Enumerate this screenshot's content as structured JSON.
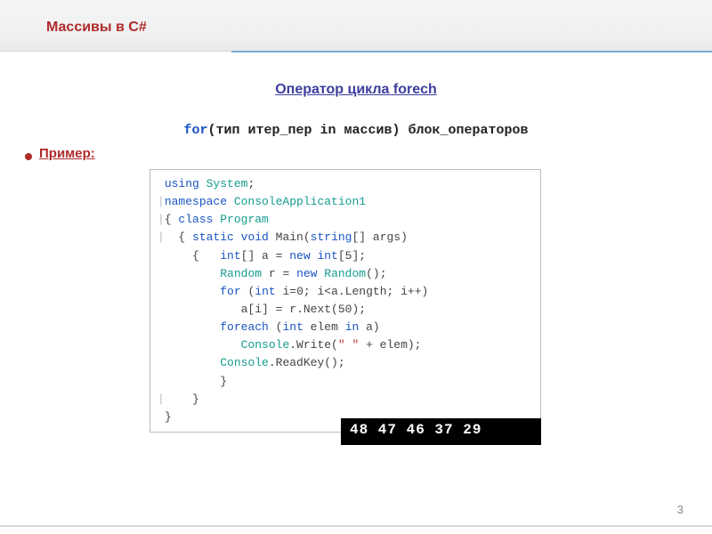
{
  "slide": {
    "title": "Массивы в C#",
    "section": "Оператор цикла forech ",
    "syntax": {
      "kw": "for",
      "rest": "(тип итер_пер in массив) блок_операторов"
    },
    "example_label": "Пример",
    "page_number": "3"
  },
  "code": {
    "lines": [
      {
        "gutter": "",
        "seg": [
          {
            "t": "kw",
            "v": "using "
          },
          {
            "t": "type",
            "v": "System"
          },
          {
            "t": "",
            "v": ";"
          }
        ]
      },
      {
        "gutter": "|",
        "seg": [
          {
            "t": "kw",
            "v": "namespace "
          },
          {
            "t": "type",
            "v": "ConsoleApplication1"
          }
        ]
      },
      {
        "gutter": "|",
        "seg": [
          {
            "t": "",
            "v": "{ "
          },
          {
            "t": "kw",
            "v": "class "
          },
          {
            "t": "type",
            "v": "Program"
          }
        ]
      },
      {
        "gutter": "|",
        "seg": [
          {
            "t": "",
            "v": "  { "
          },
          {
            "t": "kw",
            "v": "static void "
          },
          {
            "t": "",
            "v": "Main("
          },
          {
            "t": "kw",
            "v": "string"
          },
          {
            "t": "",
            "v": "[] args)"
          }
        ]
      },
      {
        "gutter": "",
        "seg": [
          {
            "t": "",
            "v": "    {   "
          },
          {
            "t": "kw",
            "v": "int"
          },
          {
            "t": "",
            "v": "[] a = "
          },
          {
            "t": "kw",
            "v": "new int"
          },
          {
            "t": "",
            "v": "[5];"
          }
        ]
      },
      {
        "gutter": "",
        "seg": [
          {
            "t": "",
            "v": "        "
          },
          {
            "t": "type",
            "v": "Random"
          },
          {
            "t": "",
            "v": " r = "
          },
          {
            "t": "kw",
            "v": "new "
          },
          {
            "t": "type",
            "v": "Random"
          },
          {
            "t": "",
            "v": "();"
          }
        ]
      },
      {
        "gutter": "",
        "seg": [
          {
            "t": "",
            "v": "        "
          },
          {
            "t": "kw",
            "v": "for "
          },
          {
            "t": "",
            "v": "("
          },
          {
            "t": "kw",
            "v": "int"
          },
          {
            "t": "",
            "v": " i=0; i<a.Length; i++)"
          }
        ]
      },
      {
        "gutter": "",
        "seg": [
          {
            "t": "",
            "v": "           a[i] = r.Next(50);"
          }
        ]
      },
      {
        "gutter": "",
        "seg": [
          {
            "t": "",
            "v": "        "
          },
          {
            "t": "kw",
            "v": "foreach "
          },
          {
            "t": "",
            "v": "("
          },
          {
            "t": "kw",
            "v": "int"
          },
          {
            "t": "",
            "v": " elem "
          },
          {
            "t": "kw",
            "v": "in"
          },
          {
            "t": "",
            "v": " a)"
          }
        ]
      },
      {
        "gutter": "",
        "seg": [
          {
            "t": "",
            "v": "           "
          },
          {
            "t": "type",
            "v": "Console"
          },
          {
            "t": "",
            "v": ".Write("
          },
          {
            "t": "str",
            "v": "\" \""
          },
          {
            "t": "",
            "v": " + elem);"
          }
        ]
      },
      {
        "gutter": "",
        "seg": [
          {
            "t": "",
            "v": "        "
          },
          {
            "t": "type",
            "v": "Console"
          },
          {
            "t": "",
            "v": ".ReadKey();"
          }
        ]
      },
      {
        "gutter": "",
        "seg": [
          {
            "t": "",
            "v": "        }"
          }
        ]
      },
      {
        "gutter": "|",
        "seg": [
          {
            "t": "",
            "v": "    }"
          }
        ]
      },
      {
        "gutter": "",
        "seg": [
          {
            "t": "",
            "v": "}"
          }
        ]
      }
    ]
  },
  "output": "48 47 46 37 29"
}
